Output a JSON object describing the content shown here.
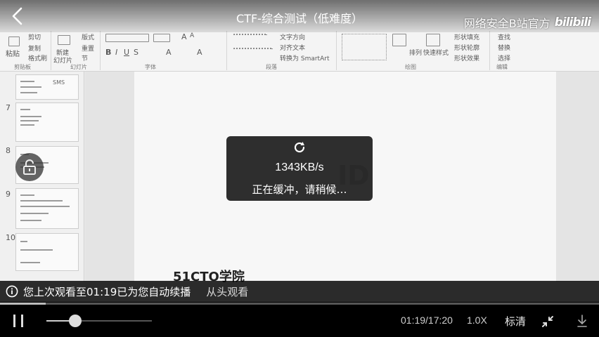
{
  "player": {
    "title": "CTF-综合测试（低难度）",
    "uploader": "网络安全B站官方",
    "platform_logo": "bilibili",
    "buffer": {
      "speed": "1343KB/s",
      "message": "正在缓冲，请稍候…"
    },
    "resume": {
      "prefix": "您上次观看至",
      "time": "01:19",
      "suffix": "已为您自动续播",
      "action": "从头观看"
    },
    "controls": {
      "time": "01:19/17:20",
      "speed": "1.0X",
      "quality": "标清"
    },
    "progress_fraction": 0.076,
    "volume_fraction": 0.27
  },
  "frame": {
    "ribbon": {
      "clipboard": {
        "paste": "粘贴",
        "cut": "剪切",
        "copy": "复制",
        "format_painter": "格式刷",
        "group": "剪贴板"
      },
      "slides": {
        "new": "新建",
        "new2": "幻灯片",
        "layout": "版式",
        "reset": "重置",
        "section": "节",
        "group": "幻灯片"
      },
      "font_group": "字体",
      "paragraph": {
        "text_dir": "文字方向",
        "align_text": "对齐文本",
        "smartart": "转换为 SmartArt",
        "group": "段落"
      },
      "drawing": {
        "arrange": "排列",
        "quick_styles": "快速样式",
        "fill": "形状填充",
        "outline": "形状轮廓",
        "effects": "形状效果",
        "group": "绘图"
      },
      "editing": {
        "find": "查找",
        "replace": "替换",
        "select": "选择",
        "group": "编辑"
      }
    },
    "thumbnails": [
      {
        "num": "7"
      },
      {
        "num": "8"
      },
      {
        "num": "9"
      },
      {
        "num": "10"
      }
    ],
    "thumb_label": "SMS",
    "slide_watermark": "51CTO学院"
  },
  "icons": {
    "back": "chevron-left-icon",
    "lock": "lock-icon",
    "buffer": "refresh-icon",
    "info": "info-icon",
    "pause": "pause-icon",
    "shrink": "exit-fullscreen-icon",
    "download": "download-icon"
  },
  "colors": {
    "overlay": "#1c1c1c",
    "text": "#ffffff",
    "muted": "#cfcfcf"
  }
}
